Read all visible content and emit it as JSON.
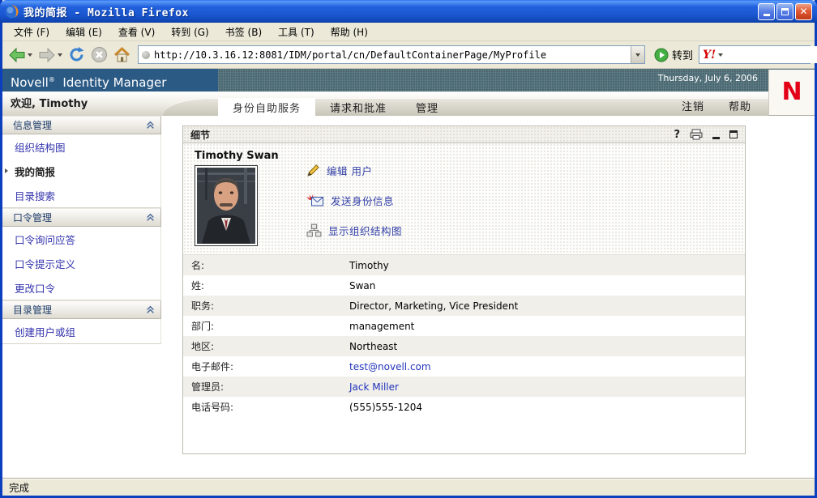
{
  "window": {
    "title": "我的简报 - Mozilla Firefox"
  },
  "menubar": {
    "items": [
      "文件 (F)",
      "编辑 (E)",
      "查看 (V)",
      "转到 (G)",
      "书签 (B)",
      "工具 (T)",
      "帮助 (H)"
    ]
  },
  "toolbar": {
    "address_url": "http://10.3.16.12:8081/IDM/portal/cn/DefaultContainerPage/MyProfile",
    "go_label": "转到",
    "search_logo": "Y!"
  },
  "banner": {
    "brand": "Novell",
    "registered": "®",
    "product": "Identity Manager",
    "date": "Thursday, July 6, 2006",
    "logo_letter": "N"
  },
  "chrome": {
    "welcome": "欢迎, Timothy",
    "tabs": [
      {
        "label": "身份自助服务"
      },
      {
        "label": "请求和批准"
      },
      {
        "label": "管理"
      }
    ],
    "logout": "注销",
    "help": "帮助"
  },
  "sidebar": {
    "sections": [
      {
        "title": "信息管理",
        "items": [
          {
            "label": "组织结构图"
          },
          {
            "label": "我的简报"
          },
          {
            "label": "目录搜索"
          }
        ]
      },
      {
        "title": "口令管理",
        "items": [
          {
            "label": "口令询问应答"
          },
          {
            "label": "口令提示定义"
          },
          {
            "label": "更改口令"
          }
        ]
      },
      {
        "title": "目录管理",
        "items": [
          {
            "label": "创建用户或组"
          }
        ]
      }
    ]
  },
  "panel": {
    "title": "细节",
    "help_glyph": "?"
  },
  "profile": {
    "name": "Timothy Swan",
    "actions": [
      {
        "label": "编辑 用户"
      },
      {
        "label": "发送身份信息"
      },
      {
        "label": "显示组织结构图"
      }
    ]
  },
  "details": {
    "rows": [
      {
        "label": "名:",
        "value": "Timothy"
      },
      {
        "label": "姓:",
        "value": "Swan"
      },
      {
        "label": "职务:",
        "value": "Director, Marketing, Vice President"
      },
      {
        "label": "部门:",
        "value": "management"
      },
      {
        "label": "地区:",
        "value": "Northeast"
      },
      {
        "label": "电子邮件:",
        "value": "test@novell.com"
      },
      {
        "label": "管理员:",
        "value": "Jack Miller"
      },
      {
        "label": "电话号码:",
        "value": "(555)555-1204"
      }
    ]
  },
  "statusbar": {
    "text": "完成"
  }
}
